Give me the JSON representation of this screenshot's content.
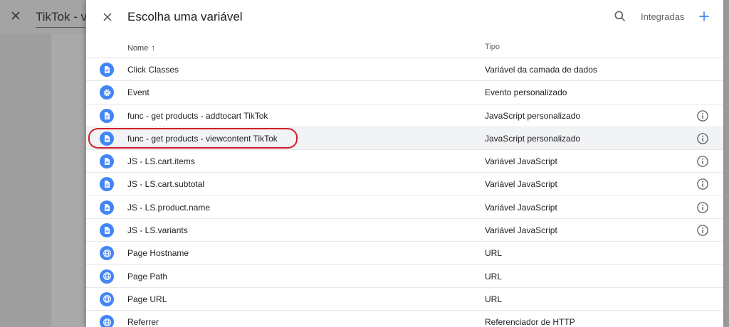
{
  "background": {
    "title": "TikTok - vi"
  },
  "dialog": {
    "title": "Escolha uma variável",
    "builtin_label": "Integradas",
    "columns": {
      "name": "Nome",
      "type": "Tipo"
    },
    "accent_color": "#4285f4",
    "highlight_color": "#d0202a",
    "rows": [
      {
        "name": "Click Classes",
        "type": "Variável da camada de dados",
        "icon": "document-icon",
        "info": false
      },
      {
        "name": "Event",
        "type": "Evento personalizado",
        "icon": "gear-icon",
        "info": false
      },
      {
        "name": "func - get products - addtocart TikTok",
        "type": "JavaScript personalizado",
        "icon": "document-icon",
        "info": true
      },
      {
        "name": "func - get products - viewcontent TikTok",
        "type": "JavaScript personalizado",
        "icon": "document-icon",
        "info": true
      },
      {
        "name": "JS - LS.cart.items",
        "type": "Variável JavaScript",
        "icon": "document-icon",
        "info": true
      },
      {
        "name": "JS - LS.cart.subtotal",
        "type": "Variável JavaScript",
        "icon": "document-icon",
        "info": true
      },
      {
        "name": "JS - LS.product.name",
        "type": "Variável JavaScript",
        "icon": "document-icon",
        "info": true
      },
      {
        "name": "JS - LS.variants",
        "type": "Variável JavaScript",
        "icon": "document-icon",
        "info": true
      },
      {
        "name": "Page Hostname",
        "type": "URL",
        "icon": "globe-icon",
        "info": false
      },
      {
        "name": "Page Path",
        "type": "URL",
        "icon": "globe-icon",
        "info": false
      },
      {
        "name": "Page URL",
        "type": "URL",
        "icon": "globe-icon",
        "info": false
      },
      {
        "name": "Referrer",
        "type": "Referenciador de HTTP",
        "icon": "globe-icon",
        "info": false
      }
    ]
  }
}
